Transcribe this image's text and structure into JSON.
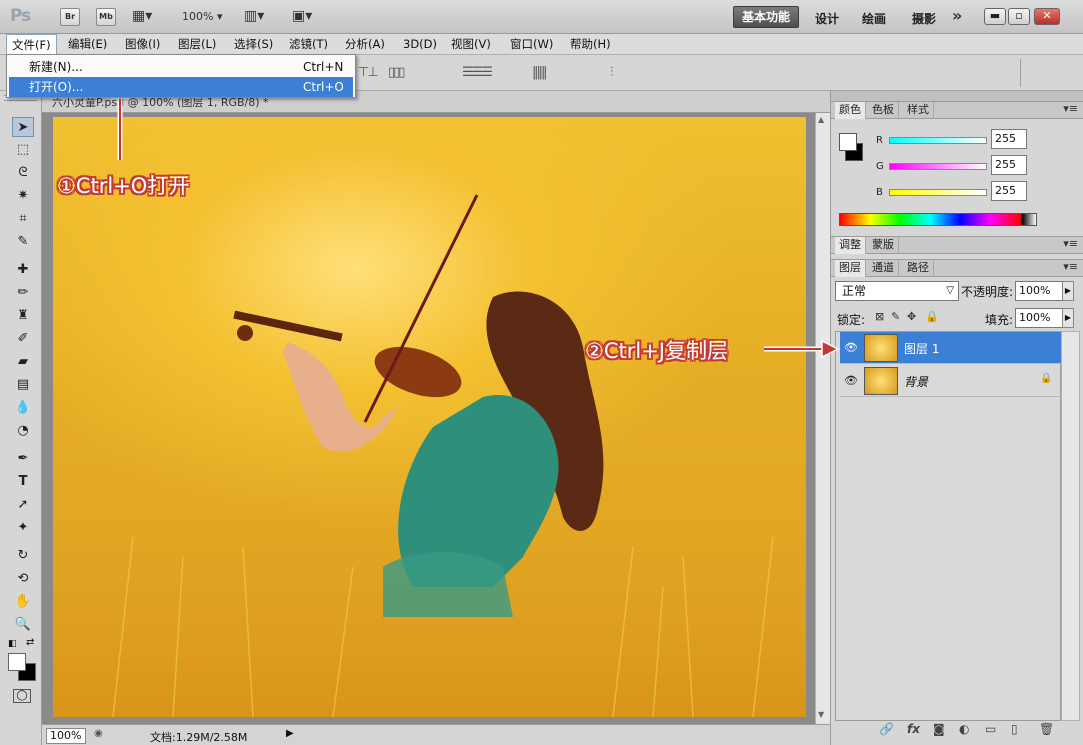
{
  "app": {
    "logo": "Ps"
  },
  "titlebar": {
    "bridge": "Br",
    "minibridge": "Mb",
    "zoom": "100%",
    "workspaces": {
      "active": "基本功能",
      "others": [
        "设计",
        "绘画",
        "摄影"
      ],
      "more": "»"
    },
    "window_buttons": [
      "▬",
      "▫",
      "✕"
    ]
  },
  "menubar": [
    "文件(F)",
    "编辑(E)",
    "图像(I)",
    "图层(L)",
    "选择(S)",
    "滤镜(T)",
    "分析(A)",
    "3D(D)",
    "视图(V)",
    "窗口(W)",
    "帮助(H)"
  ],
  "file_menu": [
    {
      "label": "新建(N)...",
      "shortcut": "Ctrl+N"
    },
    {
      "label": "打开(O)...",
      "shortcut": "Ctrl+O"
    }
  ],
  "document": {
    "tab_title": "六小灵童P.psd @ 100% (图层 1, RGB/8) *",
    "zoom": "100%",
    "info": "文档:1.29M/2.58M"
  },
  "annotations": {
    "step1": "①Ctrl+O打开",
    "step2": "②Ctrl+J复制层"
  },
  "color_panel": {
    "tabs": [
      "颜色",
      "色板",
      "样式"
    ],
    "channels": [
      {
        "label": "R",
        "value": "255"
      },
      {
        "label": "G",
        "value": "255"
      },
      {
        "label": "B",
        "value": "255"
      }
    ]
  },
  "adjust_panel": {
    "tabs": [
      "调整",
      "蒙版"
    ]
  },
  "layers_panel": {
    "tabs": [
      "图层",
      "通道",
      "路径"
    ],
    "blend_mode": "正常",
    "opacity_label": "不透明度:",
    "opacity": "100%",
    "lock_label": "锁定:",
    "fill_label": "填充:",
    "fill": "100%",
    "layers": [
      {
        "name": "图层 1",
        "selected": true
      },
      {
        "name": "背景",
        "selected": false,
        "locked": true
      }
    ]
  },
  "colors": {
    "accent": "#3c7fd6",
    "annotation": "#c43a33"
  }
}
